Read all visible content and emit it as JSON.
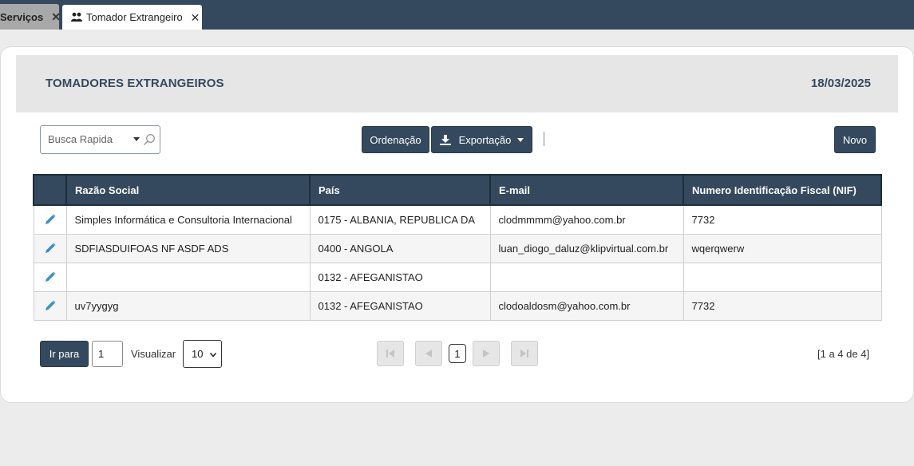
{
  "tabs": [
    {
      "label": "Serviços",
      "close": "✕"
    },
    {
      "label": "Tomador Extrangeiro",
      "close": "✕"
    }
  ],
  "header": {
    "title": "TOMADORES EXTRANGEIROS",
    "date": "18/03/2025"
  },
  "toolbar": {
    "search_placeholder": "Busca Rapida",
    "ordenacao_label": "Ordenação",
    "exportacao_label": "Exportação",
    "novo_label": "Novo"
  },
  "table": {
    "columns": [
      "Razão Social",
      "País",
      "E-mail",
      "Numero Identificação Fiscal (NIF)"
    ],
    "rows": [
      {
        "razao": "Simples Informática e Consultoria Internacional",
        "pais": "0175 - ALBANIA, REPUBLICA DA",
        "email": "clodmmmm@yahoo.com.br",
        "nif": "7732"
      },
      {
        "razao": "SDFIASDUIFOAS NF ASDF ADS",
        "pais": "0400 - ANGOLA",
        "email": "luan_diogo_daluz@klipvirtual.com.br",
        "nif": "wqerqwerw"
      },
      {
        "razao": "",
        "pais": "0132 - AFEGANISTAO",
        "email": "",
        "nif": ""
      },
      {
        "razao": "uv7yygyg",
        "pais": "0132 - AFEGANISTAO",
        "email": "clodoaldosm@yahoo.com.br",
        "nif": "7732"
      }
    ]
  },
  "pagination": {
    "ir_para_label": "Ir para",
    "page_input_value": "1",
    "visualizar_label": "Visualizar",
    "page_size": "10",
    "current_page": "1",
    "info": "[1 a 4 de 4]"
  },
  "colors": {
    "primary": "#34495e",
    "band": "#e6e6e6",
    "pencil": "#3a8fc7"
  },
  "icons": {
    "tab_icon": "users-icon",
    "edit": "pencil-icon",
    "export": "download-icon",
    "search": "magnifier-icon"
  }
}
